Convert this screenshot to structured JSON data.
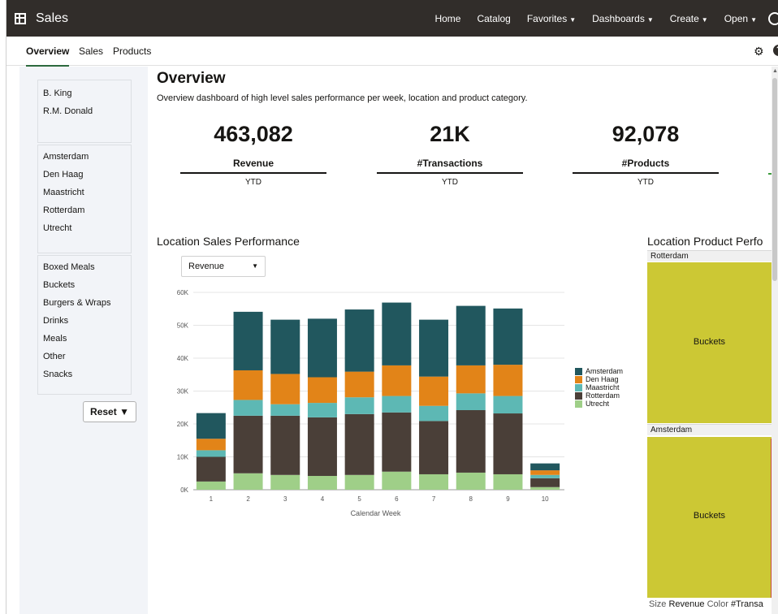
{
  "header": {
    "title": "Sales",
    "nav": [
      {
        "label": "Home",
        "caret": false
      },
      {
        "label": "Catalog",
        "caret": false
      },
      {
        "label": "Favorites",
        "caret": true
      },
      {
        "label": "Dashboards",
        "caret": true
      },
      {
        "label": "Create",
        "caret": true
      },
      {
        "label": "Open",
        "caret": true
      }
    ]
  },
  "tabs": [
    "Overview",
    "Sales",
    "Products"
  ],
  "sidebar": {
    "salespeople": [
      "B. King",
      "R.M. Donald"
    ],
    "locations": [
      "Amsterdam",
      "Den Haag",
      "Maastricht",
      "Rotterdam",
      "Utrecht"
    ],
    "categories": [
      "Boxed Meals",
      "Buckets",
      "Burgers & Wraps",
      "Drinks",
      "Meals",
      "Other",
      "Snacks"
    ],
    "reset_label": "Reset ▼"
  },
  "overview": {
    "title": "Overview",
    "description": "Overview dashboard of high level sales performance per week, location and product category."
  },
  "kpis": [
    {
      "value": "463,082",
      "label": "Revenue",
      "sub": "YTD"
    },
    {
      "value": "21K",
      "label": "#Transactions",
      "sub": "YTD"
    },
    {
      "value": "92,078",
      "label": "#Products",
      "sub": "YTD"
    }
  ],
  "location_sales": {
    "title": "Location Sales Performance",
    "measure": "Revenue"
  },
  "chart_data": {
    "type": "bar",
    "stacked": true,
    "categories": [
      "1",
      "2",
      "3",
      "4",
      "5",
      "6",
      "7",
      "8",
      "9",
      "10"
    ],
    "xlabel": "Calendar Week",
    "ylabel": "",
    "ylim": [
      0,
      60000
    ],
    "yticks": [
      "0K",
      "10K",
      "20K",
      "30K",
      "40K",
      "50K",
      "60K"
    ],
    "legend_position": "right",
    "series": [
      {
        "name": "Utrecht",
        "color": "#9fcf88",
        "values": [
          2500,
          5000,
          4500,
          4200,
          4500,
          5500,
          4700,
          5200,
          4700,
          800
        ]
      },
      {
        "name": "Rotterdam",
        "color": "#4a3f38",
        "values": [
          7500,
          17500,
          18000,
          17800,
          18500,
          18000,
          16200,
          19000,
          18500,
          2700
        ]
      },
      {
        "name": "Maastricht",
        "color": "#5db8b4",
        "values": [
          2000,
          4800,
          3500,
          4400,
          5100,
          5000,
          4600,
          5100,
          5300,
          1000
        ]
      },
      {
        "name": "Den Haag",
        "color": "#e28418",
        "values": [
          3500,
          9000,
          9200,
          7800,
          7800,
          9300,
          8900,
          8500,
          9500,
          1400
        ]
      },
      {
        "name": "Amsterdam",
        "color": "#21575e",
        "values": [
          7800,
          17800,
          16500,
          17800,
          18900,
          19100,
          17300,
          18100,
          17100,
          2100
        ]
      }
    ]
  },
  "location_product": {
    "title": "Location Product Perfo",
    "groups": [
      {
        "name": "Rotterdam",
        "cell": "Buckets"
      },
      {
        "name": "Amsterdam",
        "cell": "Buckets"
      }
    ],
    "footer": {
      "size_label": "Size",
      "size_value": "Revenue",
      "color_label": "Color",
      "color_value": "#Transa"
    },
    "color": "#ccc834"
  }
}
